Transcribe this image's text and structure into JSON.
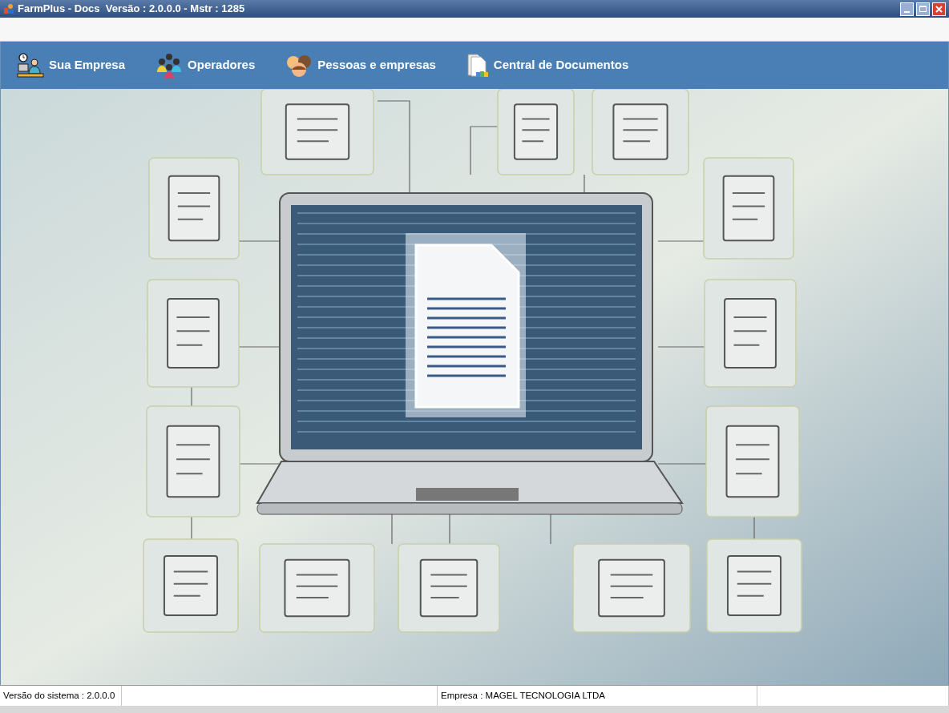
{
  "window": {
    "title": "FarmPlus - Docs  Versão : 2.0.0.0 - Mstr : 1285"
  },
  "menu": [
    {
      "label": "Sua Empresa",
      "kind": "company"
    },
    {
      "label": "Operadores",
      "kind": "operators"
    },
    {
      "label": "Pessoas e empresas",
      "kind": "people"
    },
    {
      "label": "Central de Documentos",
      "kind": "documents"
    }
  ],
  "status_bar": [
    {
      "kind": "text",
      "text": "Versão do sistema : 2.0.0.0"
    },
    {
      "kind": "blank"
    },
    {
      "kind": "text",
      "text": "Empresa : MAGEL TECNOLOGIA LTDA"
    },
    {
      "kind": "blank"
    }
  ]
}
